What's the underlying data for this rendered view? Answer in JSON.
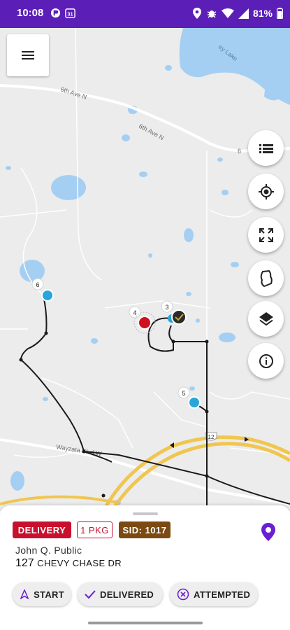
{
  "status_bar": {
    "time": "10:08",
    "battery": "81%",
    "calendar_day": "31"
  },
  "map": {
    "road_labels": {
      "sixth_ave_1": "6th Ave N",
      "sixth_ave_2": "6th Ave N",
      "sixth_ave_3": "6",
      "wayzata": "Wayzata Blvd W",
      "highway": "12",
      "lake": "ey Lake"
    },
    "stops": [
      {
        "number": "6",
        "color": "#29a6d9"
      },
      {
        "number": "4",
        "color": "#d0101e"
      },
      {
        "number": "3",
        "color": "#2a2a2a"
      },
      {
        "number": "5",
        "color": "#29a6d9"
      }
    ],
    "controls": [
      "list-icon",
      "locate-icon",
      "fullscreen-icon",
      "boundary-icon",
      "layers-icon",
      "info-icon"
    ]
  },
  "sheet": {
    "type_badge": "DELIVERY",
    "packages_badge": "1 PKG",
    "sid_badge": "SID: 1017",
    "customer_name": "John Q. Public",
    "house_number": "127",
    "street": "CHEVY CHASE DR",
    "actions": {
      "start": "START",
      "delivered": "DELIVERED",
      "attempted": "ATTEMPTED"
    }
  },
  "colors": {
    "status_bar": "#5b1fb8",
    "accent": "#6a1fd6",
    "delivery_red": "#c8102e",
    "sid_brown": "#7a4a12",
    "water": "#a5cff2"
  }
}
